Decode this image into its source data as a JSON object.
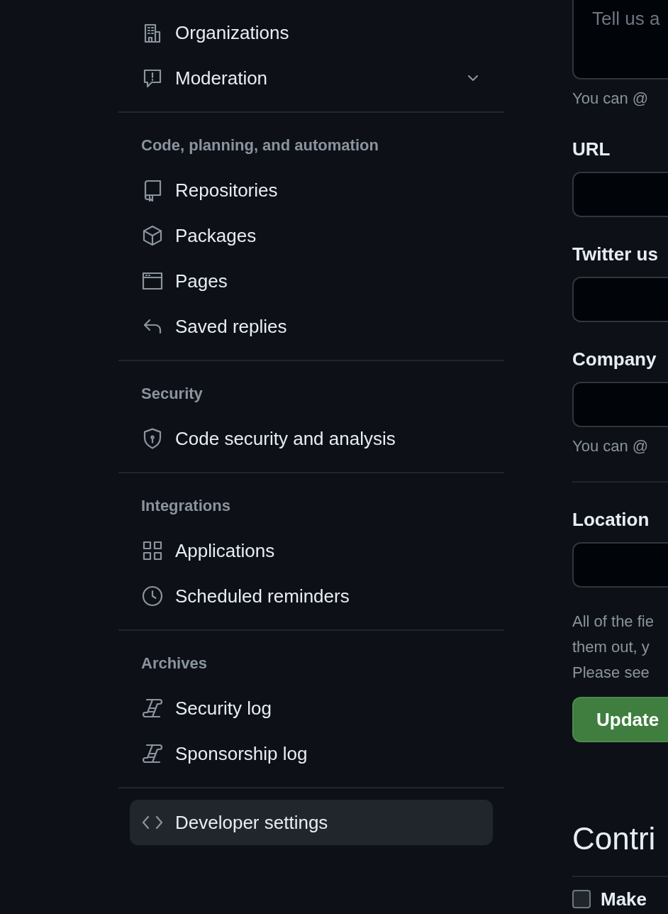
{
  "sidebar": {
    "sections": [
      {
        "items": [
          {
            "label": "Organizations",
            "selected": false
          },
          {
            "label": "Moderation",
            "selected": false,
            "expanded": false
          }
        ]
      },
      {
        "heading": "Code, planning, and automation",
        "items": [
          {
            "label": "Repositories",
            "selected": false
          },
          {
            "label": "Packages",
            "selected": false
          },
          {
            "label": "Pages",
            "selected": false
          },
          {
            "label": "Saved replies",
            "selected": false
          }
        ]
      },
      {
        "heading": "Security",
        "items": [
          {
            "label": "Code security and analysis",
            "selected": false
          }
        ]
      },
      {
        "heading": "Integrations",
        "items": [
          {
            "label": "Applications",
            "selected": false
          },
          {
            "label": "Scheduled reminders",
            "selected": false
          }
        ]
      },
      {
        "heading": "Archives",
        "items": [
          {
            "label": "Security log",
            "selected": false
          },
          {
            "label": "Sponsorship log",
            "selected": false
          }
        ]
      },
      {
        "items": [
          {
            "label": "Developer settings",
            "selected": true
          }
        ]
      }
    ]
  },
  "profile_form": {
    "bio": {
      "placeholder": "Tell us a"
    },
    "bio_note": "You can @",
    "fields": [
      {
        "label": "URL"
      },
      {
        "label": "Twitter us"
      },
      {
        "label": "Company",
        "note": "You can @"
      }
    ],
    "location": {
      "label": "Location"
    },
    "info_lines": [
      "All of the fie",
      "them out, y",
      "Please see"
    ],
    "update_button": "Update"
  },
  "contributions": {
    "title": "Contri",
    "options": [
      {
        "label": "Make",
        "checked": false
      }
    ]
  }
}
